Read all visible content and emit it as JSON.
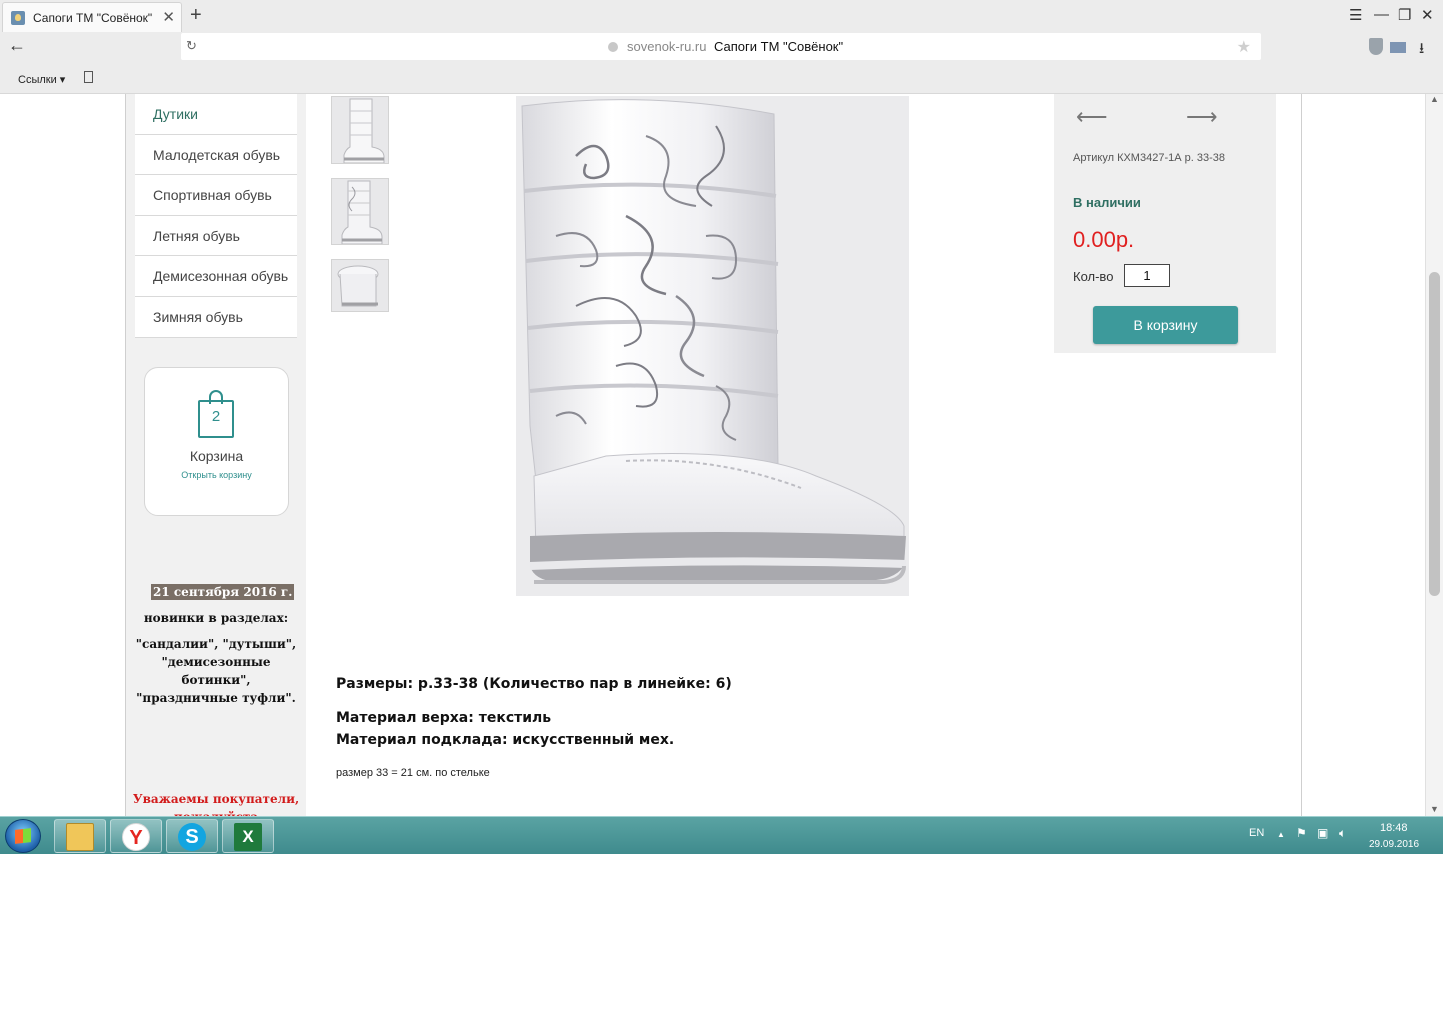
{
  "browser": {
    "tab_title": "Сапоги ТМ \"Совёнок\"",
    "tab_close": "✕",
    "new_tab": "+",
    "url_domain": "sovenok-ru.ru",
    "url_title": "Сапоги ТМ \"Совёнок\"",
    "bookmarks_label": "Ссылки",
    "icons": [
      "favicon",
      "close-icon",
      "plus-icon",
      "menu-icon",
      "minimize-icon",
      "restore-icon",
      "close-window-icon",
      "back-arrow-icon",
      "reload-icon",
      "lock-icon",
      "star-icon",
      "shield-icon",
      "mail-icon",
      "download-icon",
      "page-icon"
    ]
  },
  "sidebar": {
    "menu": [
      {
        "label": "Дутики"
      },
      {
        "label": "Малодетская обувь"
      },
      {
        "label": "Спортивная обувь"
      },
      {
        "label": "Летняя обувь"
      },
      {
        "label": "Демисезонная обувь"
      },
      {
        "label": "Зимняя обувь"
      }
    ],
    "cart": {
      "count": "2",
      "title": "Корзина",
      "open_link": "Открыть корзину"
    },
    "news": {
      "date": "21 сентября 2016 г.",
      "headline": "новинки в разделах:",
      "lines": [
        "\"сандалии\", \"дутыши\",",
        "\"демисезонные",
        "ботинки\",",
        "\"праздничные туфли\"."
      ],
      "attention": "Уважаемы покупатели,",
      "attention_cut": "пожалуйста"
    }
  },
  "product": {
    "sku": "Артикул КХМ3427-1А р. 33-38",
    "availability": "В наличии",
    "price": "0.00р.",
    "qty_label": "Кол-во",
    "qty_value": "1",
    "add_to_cart": "В корзину",
    "nav_prev": "⟵",
    "nav_next": "⟶",
    "sizes": "Размеры: р.33-38 (Количество пар в линейке: 6)",
    "material_top": "Материал верха: текстиль",
    "material_lining": "Материал подклада: искусственный мех.",
    "size_note": "размер 33 = 21 см. по стельке"
  },
  "taskbar": {
    "lang": "EN",
    "time": "18:48",
    "date": "29.09.2016",
    "apps": [
      "folder-icon",
      "yandex-icon",
      "skype-icon",
      "excel-icon"
    ],
    "yandex_glyph": "Y",
    "skype_glyph": "S",
    "excel_glyph": "X"
  },
  "colors": {
    "accent_teal": "#3d9a9b",
    "price_red": "#e02020",
    "instock_green": "#2f6f62",
    "taskbar": "#4a9597"
  }
}
